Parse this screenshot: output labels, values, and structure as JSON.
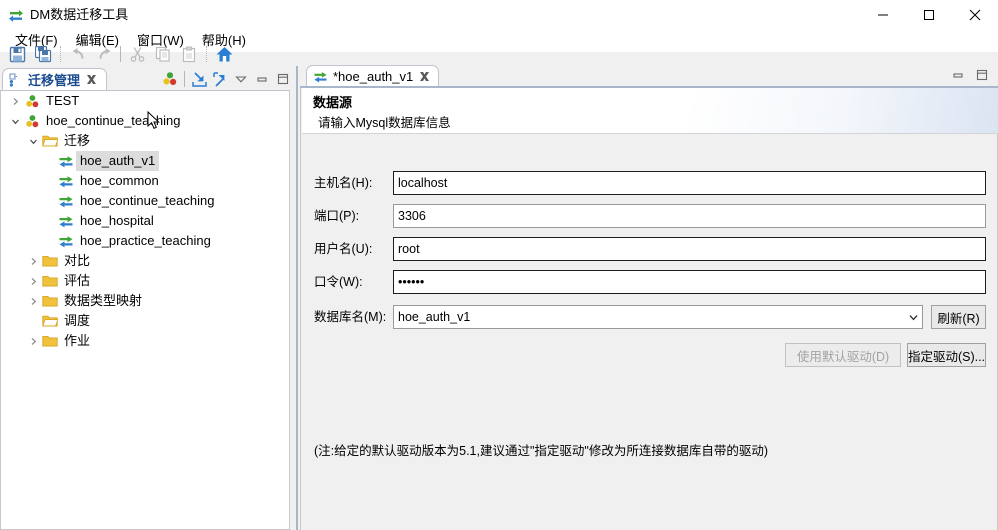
{
  "window": {
    "title": "DM数据迁移工具",
    "icon": "migrate-icon",
    "controls": {
      "minimize": "minimize-icon",
      "maximize": "maximize-icon",
      "close": "close-icon"
    }
  },
  "menubar": {
    "items": [
      {
        "label": "文件(F)",
        "name": "menu-file"
      },
      {
        "label": "编辑(E)",
        "name": "menu-edit"
      },
      {
        "label": "窗口(W)",
        "name": "menu-window"
      },
      {
        "label": "帮助(H)",
        "name": "menu-help"
      }
    ]
  },
  "toolbar": {
    "items": [
      {
        "name": "save-icon",
        "enabled": true
      },
      {
        "name": "save-all-icon",
        "enabled": true
      },
      {
        "name": "undo-icon",
        "enabled": false
      },
      {
        "name": "redo-icon",
        "enabled": false
      },
      {
        "name": "cut-icon",
        "enabled": false
      },
      {
        "name": "copy-icon",
        "enabled": false
      },
      {
        "name": "paste-icon",
        "enabled": false
      },
      {
        "name": "home-icon",
        "enabled": true
      }
    ]
  },
  "left_view": {
    "tab_label": "迁移管理",
    "tab_icon": "migration-manager-icon",
    "close_icon": "close-view-icon",
    "tools": [
      {
        "name": "connections-icon"
      },
      {
        "name": "import-icon"
      },
      {
        "name": "export-icon"
      },
      {
        "name": "view-menu-icon"
      },
      {
        "name": "view-minimize-icon"
      },
      {
        "name": "view-maximize-icon"
      }
    ],
    "tree": [
      {
        "label": "TEST",
        "icon": "connection-icon",
        "indent": 0,
        "twisty": "collapsed",
        "selected": false
      },
      {
        "label": "hoe_continue_teaching",
        "icon": "connection-icon",
        "indent": 0,
        "twisty": "expanded",
        "selected": false
      },
      {
        "label": "迁移",
        "icon": "folder-open-icon",
        "indent": 1,
        "twisty": "expanded",
        "selected": false
      },
      {
        "label": "hoe_auth_v1",
        "icon": "migration-icon",
        "indent": 2,
        "twisty": "none",
        "selected": true
      },
      {
        "label": "hoe_common",
        "icon": "migration-icon",
        "indent": 2,
        "twisty": "none",
        "selected": false
      },
      {
        "label": "hoe_continue_teaching",
        "icon": "migration-icon",
        "indent": 2,
        "twisty": "none",
        "selected": false
      },
      {
        "label": "hoe_hospital",
        "icon": "migration-icon",
        "indent": 2,
        "twisty": "none",
        "selected": false
      },
      {
        "label": "hoe_practice_teaching",
        "icon": "migration-icon",
        "indent": 2,
        "twisty": "none",
        "selected": false
      },
      {
        "label": "对比",
        "icon": "folder-icon",
        "indent": 1,
        "twisty": "collapsed",
        "selected": false
      },
      {
        "label": "评估",
        "icon": "folder-icon",
        "indent": 1,
        "twisty": "collapsed",
        "selected": false
      },
      {
        "label": "数据类型映射",
        "icon": "folder-icon",
        "indent": 1,
        "twisty": "collapsed",
        "selected": false
      },
      {
        "label": "调度",
        "icon": "folder-open-icon",
        "indent": 1,
        "twisty": "none",
        "selected": false
      },
      {
        "label": "作业",
        "icon": "folder-icon",
        "indent": 1,
        "twisty": "collapsed",
        "selected": false
      }
    ]
  },
  "editor": {
    "tab_label": "*hoe_auth_v1",
    "tab_icon": "migration-icon",
    "tab_close_icon": "close-tab-icon",
    "tools": [
      {
        "name": "editor-minimize-icon"
      },
      {
        "name": "editor-maximize-icon"
      }
    ],
    "header": {
      "title": "数据源",
      "subtitle": "请输入Mysql数据库信息"
    },
    "fields": [
      {
        "label": "主机名(H):",
        "value": "localhost",
        "name": "host-field",
        "placeholder": ""
      },
      {
        "label": "端口(P):",
        "value": "3306",
        "name": "port-field",
        "placeholder": ""
      },
      {
        "label": "用户名(U):",
        "value": "root",
        "name": "user-field",
        "placeholder": ""
      },
      {
        "label": "口令(W):",
        "value": "••••••",
        "name": "password-field",
        "placeholder": ""
      }
    ],
    "database": {
      "label": "数据库名(M):",
      "value": "hoe_auth_v1",
      "options": [
        "hoe_auth_v1"
      ],
      "refresh_label": "刷新(R)"
    },
    "driver": {
      "default_label": "使用默认驱动(D)",
      "default_enabled": false,
      "specify_label": "指定驱动(S)..."
    },
    "note": "(注:给定的默认驱动版本为5.1,建议通过\"指定驱动\"修改为所连接数据库自带的驱动)"
  },
  "colors": {
    "accent": "#1b4b8f",
    "sash": "#a8b6cc",
    "selection": "#dcdcdc",
    "green": "#3fa535",
    "blue": "#2f7fd0",
    "folder": "#e8b73a"
  }
}
